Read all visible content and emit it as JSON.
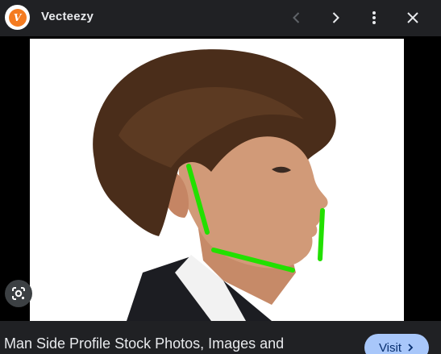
{
  "header": {
    "source_name": "Vecteezy",
    "logo_letter": "V"
  },
  "icons": {
    "prev": "chevron-left-icon",
    "next": "chevron-right-icon",
    "more": "more-vert-icon",
    "close": "close-icon",
    "lens": "google-lens-icon",
    "visit_chevron": "chevron-right-icon"
  },
  "image": {
    "alt": "Man side profile with green jawline lines"
  },
  "footer": {
    "title": "Man Side Profile Stock Photos, Images and",
    "visit_label": "Visit"
  },
  "colors": {
    "background": "#202124",
    "accent_button": "#a8c7fa",
    "brand_logo": "#f47b20",
    "annotation_green": "#22e000"
  }
}
